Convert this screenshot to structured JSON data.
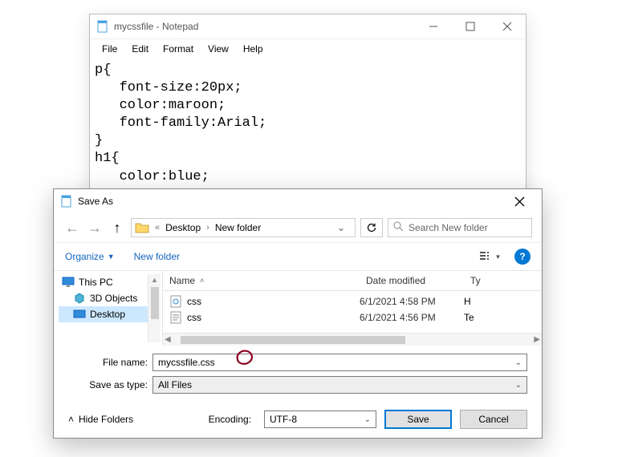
{
  "notepad": {
    "title": "mycssfile - Notepad",
    "menu": [
      "File",
      "Edit",
      "Format",
      "View",
      "Help"
    ],
    "content": "p{\n   font-size:20px;\n   color:maroon;\n   font-family:Arial;\n}\nh1{\n   color:blue;"
  },
  "saveas": {
    "title": "Save As",
    "breadcrumb": {
      "prefix": "«",
      "part1": "Desktop",
      "part2": "New folder"
    },
    "search_placeholder": "Search New folder",
    "toolbar": {
      "organize": "Organize",
      "new_folder": "New folder"
    },
    "sidebar": {
      "this_pc": "This PC",
      "items": [
        "3D Objects",
        "Desktop"
      ],
      "selected_index": 1
    },
    "columns": {
      "name": "Name",
      "date": "Date modified",
      "type": "Ty"
    },
    "rows": [
      {
        "name": "css",
        "date": "6/1/2021 4:58 PM",
        "type": "H",
        "icon": "html"
      },
      {
        "name": "css",
        "date": "6/1/2021 4:56 PM",
        "type": "Te",
        "icon": "text"
      }
    ],
    "filename_label": "File name:",
    "filename_value": "mycssfile.css",
    "savetype_label": "Save as type:",
    "savetype_value": "All Files",
    "hide_folders": "Hide Folders",
    "encoding_label": "Encoding:",
    "encoding_value": "UTF-8",
    "save_label": "Save",
    "cancel_label": "Cancel"
  }
}
